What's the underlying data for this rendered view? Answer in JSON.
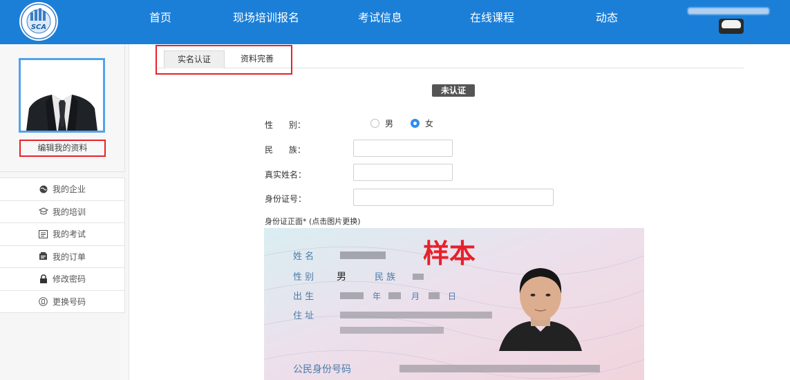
{
  "nav": {
    "items": [
      "首页",
      "现场培训报名",
      "考试信息",
      "在线课程",
      "动态"
    ],
    "logo_text": "SCA"
  },
  "sidebar": {
    "edit_profile": "编辑我的资料",
    "menu": [
      {
        "label": "我的企业",
        "icon": "globe-icon"
      },
      {
        "label": "我的培训",
        "icon": "training-icon"
      },
      {
        "label": "我的考试",
        "icon": "exam-icon"
      },
      {
        "label": "我的订单",
        "icon": "order-icon"
      },
      {
        "label": "修改密码",
        "icon": "lock-icon"
      },
      {
        "label": "更换号码",
        "icon": "phone-icon"
      }
    ]
  },
  "tabs": [
    "实名认证",
    "资料完善"
  ],
  "status": "未认证",
  "form": {
    "gender_label": "性      别：",
    "gender_options": [
      "男",
      "女"
    ],
    "gender_selected": "女",
    "ethnicity_label": "民      族：",
    "name_label": "真实姓名：",
    "idnum_label": "身份证号：",
    "id_front_caption": "身份证正面* (点击图片更换)"
  },
  "id_card": {
    "watermark": "样本",
    "name_label": "姓 名",
    "gender_label": "性 别",
    "gender_value": "男",
    "ethnicity_label": "民 族",
    "birth_label": "出 生",
    "year": "年",
    "month": "月",
    "day": "日",
    "address_label": "住 址",
    "idnum_label": "公民身份号码"
  },
  "colors": {
    "nav_bg": "#1b7fd8",
    "highlight": "#e8202a",
    "radio_on": "#2f8cf0"
  }
}
